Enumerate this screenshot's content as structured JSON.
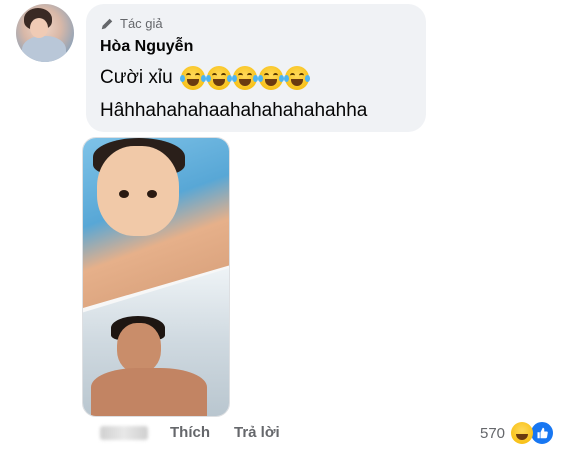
{
  "comment": {
    "author_badge": "Tác giả",
    "author_name": "Hòa Nguyễn",
    "text_line1": "Cười xỉu",
    "text_line2": "Hâhhahahahaahahahahahahha",
    "emoji_icons": [
      "laughing-tears-icon",
      "laughing-tears-icon",
      "laughing-tears-icon",
      "laughing-tears-icon",
      "laughing-tears-icon"
    ]
  },
  "actions": {
    "like_label": "Thích",
    "reply_label": "Trả lời"
  },
  "reactions": {
    "count": "570",
    "icons": [
      "haha-icon",
      "like-icon"
    ]
  },
  "colors": {
    "bubble_bg": "#f0f2f5",
    "muted_text": "#65676b",
    "like_blue": "#1877f2"
  }
}
